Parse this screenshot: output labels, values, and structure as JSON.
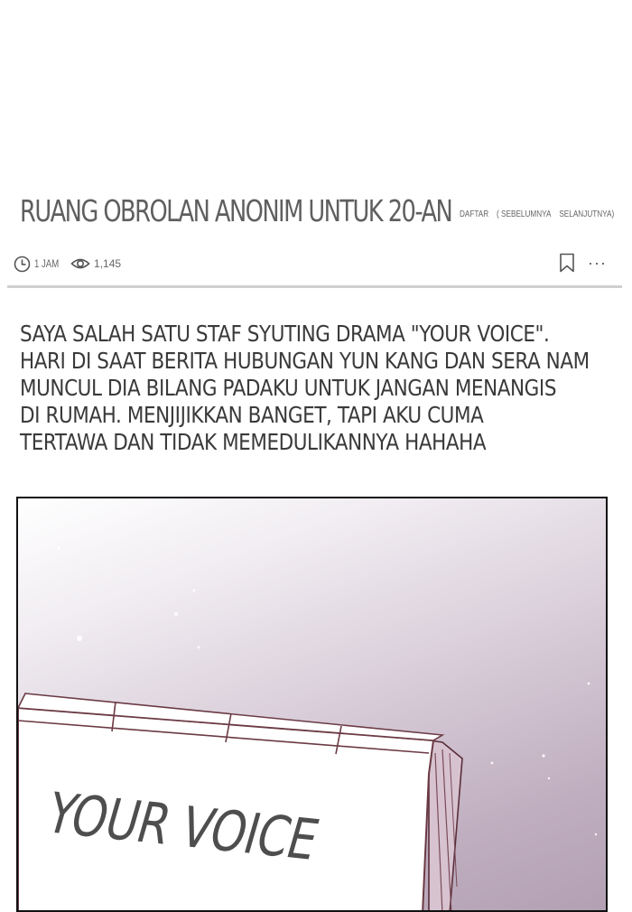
{
  "header": {
    "board_title": "RUANG OBROLAN ANONIM UNTUK 20-AN",
    "nav": {
      "list": "DAFTAR",
      "prev": "( SEBELUMNYA",
      "next": "SELANJUTNYA)"
    }
  },
  "meta": {
    "time_ago": "1 JAM",
    "views": "1,145",
    "clock_icon": "clock-icon",
    "eye_icon": "eye-icon",
    "bookmark_icon": "bookmark-icon",
    "more_icon": "more-icon",
    "more_glyph": "···"
  },
  "post": {
    "lines": [
      "SAYA SALAH SATU STAF SYUTING DRAMA \"YOUR VOICE\".",
      "HARI DI SAAT BERITA HUBUNGAN YUN KANG DAN SERA NAM",
      "MUNCUL DIA BILANG PADAKU UNTUK JANGAN MENANGIS",
      "DI RUMAH. MENJIJIKKAN BANGET, TAPI AKU CUMA",
      "TERTAWA DAN TIDAK MEMEDULIKANNYA HAHAHA"
    ]
  },
  "panel": {
    "cover_title": "YOUR VOICE"
  },
  "colors": {
    "title_gray": "#5f5f5f",
    "divider": "#cfcfcf",
    "panel_purple": "#b3a1b3"
  }
}
